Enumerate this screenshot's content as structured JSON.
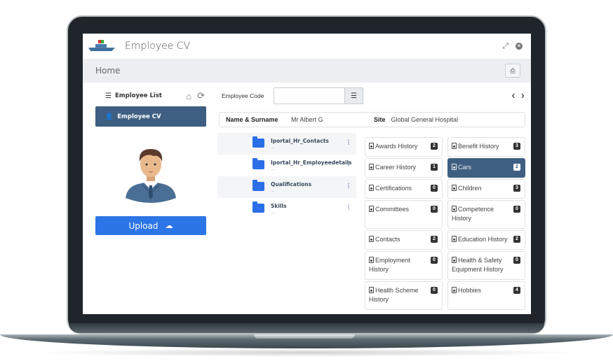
{
  "app": {
    "title": "Employee CV",
    "breadcrumb": "Home"
  },
  "titlebar": {
    "expand_icon": "expand-icon",
    "close_icon": "close-icon"
  },
  "toolbar": {
    "print_icon": "print-icon"
  },
  "sidebar": {
    "employee_list_label": "Employee List",
    "employee_cv_label": "Employee CV",
    "upload_label": "Upload"
  },
  "search": {
    "label": "Employee Code",
    "value": "",
    "placeholder": ""
  },
  "employee": {
    "name_label": "Name & Surname",
    "name_value": "Mr Albert G",
    "site_label": "Site",
    "site_value": "Global General Hospital"
  },
  "folders": [
    {
      "name": "Iportal_Hr_Contacts",
      "sub": "..."
    },
    {
      "name": "Iportal_Hr_Employeedetails",
      "sub": "..."
    },
    {
      "name": "Qualifications",
      "sub": "..."
    },
    {
      "name": "Skills",
      "sub": "..."
    }
  ],
  "categories": [
    {
      "label": "Awards History",
      "count": "2",
      "selected": false
    },
    {
      "label": "Benefit History",
      "count": "3",
      "selected": false
    },
    {
      "label": "Career History",
      "count": "1",
      "selected": false
    },
    {
      "label": "Cars",
      "count": "2",
      "selected": true
    },
    {
      "label": "Certifications",
      "count": "0",
      "selected": false
    },
    {
      "label": "Children",
      "count": "3",
      "selected": false
    },
    {
      "label": "Committees",
      "count": "0",
      "selected": false
    },
    {
      "label": "Competence History",
      "count": "0",
      "selected": false
    },
    {
      "label": "Contacts",
      "count": "2",
      "selected": false
    },
    {
      "label": "Education History",
      "count": "2",
      "selected": false
    },
    {
      "label": "Employment History",
      "count": "0",
      "selected": false
    },
    {
      "label": "Health & Safety Equipment History",
      "count": "0",
      "selected": false
    },
    {
      "label": "Health Scheme History",
      "count": "0",
      "selected": false
    },
    {
      "label": "Hobbies",
      "count": "4",
      "selected": false
    }
  ],
  "colors": {
    "primary_dark": "#3f5f82",
    "upload_blue": "#2b75e6",
    "folder_blue": "#2b6fe8"
  }
}
